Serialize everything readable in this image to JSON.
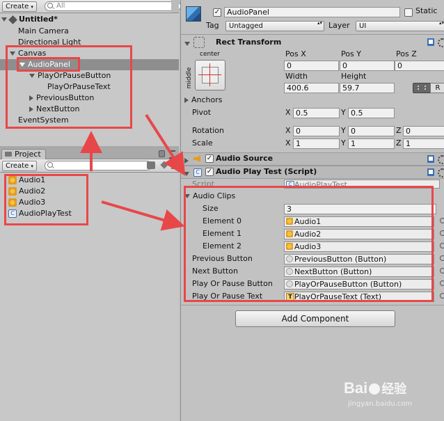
{
  "hierarchy": {
    "create_label": "Create",
    "search_placeholder": "All",
    "scene_title": "Untitled*",
    "items": [
      {
        "label": "Main Camera"
      },
      {
        "label": "Directional Light"
      },
      {
        "label": "Canvas"
      },
      {
        "label": "AudioPanel"
      },
      {
        "label": "PlayOrPauseButton"
      },
      {
        "label": "PlayOrPauseText"
      },
      {
        "label": "PreviousButton"
      },
      {
        "label": "NextButton"
      },
      {
        "label": "EventSystem"
      }
    ]
  },
  "project": {
    "tab_label": "Project",
    "create_label": "Create",
    "assets": [
      {
        "label": "Audio1",
        "icon": "audio-clip-icon"
      },
      {
        "label": "Audio2",
        "icon": "audio-clip-icon"
      },
      {
        "label": "Audio3",
        "icon": "audio-clip-icon"
      },
      {
        "label": "AudioPlayTest",
        "icon": "script-icon"
      }
    ]
  },
  "inspector": {
    "object_name": "AudioPanel",
    "static_label": "Static",
    "tag_label": "Tag",
    "tag_value": "Untagged",
    "layer_label": "Layer",
    "layer_value": "UI",
    "rect_transform": {
      "title": "Rect Transform",
      "anchor_h": "center",
      "anchor_v": "middle",
      "pos_x_label": "Pos X",
      "pos_y_label": "Pos Y",
      "pos_z_label": "Pos Z",
      "pos_x": "0",
      "pos_y": "0",
      "pos_z": "0",
      "width_label": "Width",
      "height_label": "Height",
      "width": "400.6",
      "height": "59.7",
      "raw_btn": "R",
      "anchors_label": "Anchors",
      "pivot_label": "Pivot",
      "pivot_x": "0.5",
      "pivot_y": "0.5",
      "rotation_label": "Rotation",
      "rot_x": "0",
      "rot_y": "0",
      "rot_z": "0",
      "scale_label": "Scale",
      "scale_x": "1",
      "scale_y": "1",
      "scale_z": "1",
      "x": "X",
      "y": "Y",
      "z": "Z"
    },
    "audio_source": {
      "title": "Audio Source"
    },
    "play_test": {
      "title": "Audio Play Test (Script)",
      "script_label": "Script",
      "script_value": "AudioPlayTest",
      "clips_label": "Audio Clips",
      "size_label": "Size",
      "size_value": "3",
      "elements": [
        {
          "label": "Element 0",
          "value": "Audio1"
        },
        {
          "label": "Element 1",
          "value": "Audio2"
        },
        {
          "label": "Element 2",
          "value": "Audio3"
        }
      ],
      "refs": [
        {
          "label": "Previous Button",
          "value": "PreviousButton (Button)",
          "icon": "button-icon"
        },
        {
          "label": "Next Button",
          "value": "NextButton (Button)",
          "icon": "button-icon"
        },
        {
          "label": "Play Or Pause Button",
          "value": "PlayOrPauseButton (Button)",
          "icon": "button-icon"
        },
        {
          "label": "Play Or Pause Text",
          "value": "PlayOrPauseText (Text)",
          "icon": "text-icon"
        }
      ]
    },
    "add_component": "Add Component"
  },
  "watermark": {
    "brand": "Bai",
    "brand2": "经验",
    "url": "jingyan.baidu.com"
  },
  "colors": {
    "highlight": "#e8474a",
    "selection": "#8e8e8e"
  }
}
